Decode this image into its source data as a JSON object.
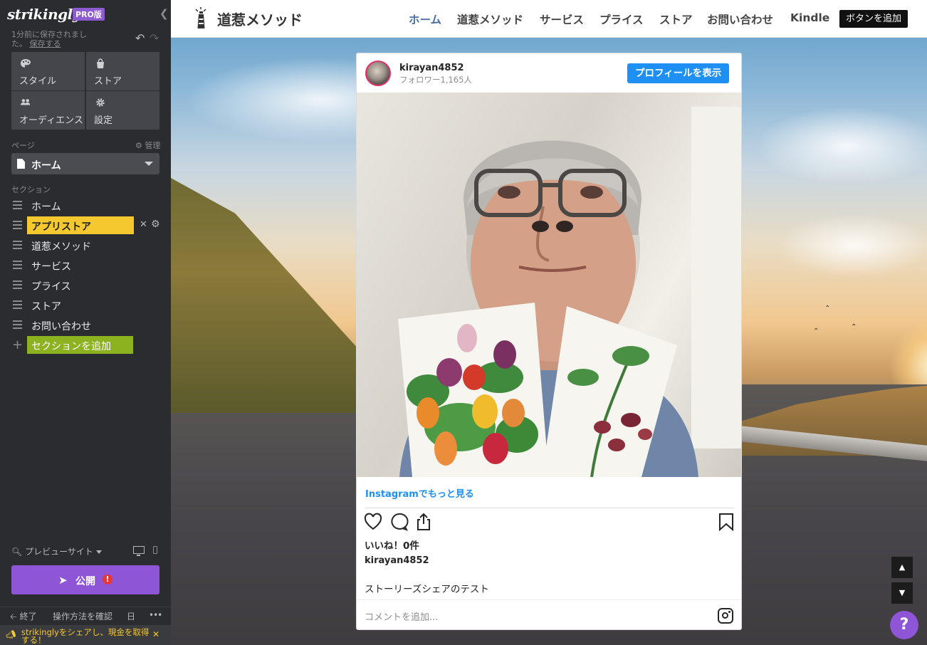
{
  "sidebar": {
    "brand": "strikingly",
    "pro_badge": "PRO版",
    "saved_text": "1分前に保存されました。",
    "save_link": "保存する",
    "tiles": [
      {
        "label": "スタイル",
        "icon": "palette-icon"
      },
      {
        "label": "ストア",
        "icon": "shopping-bag-icon"
      },
      {
        "label": "オーディエンス",
        "icon": "people-icon"
      },
      {
        "label": "設定",
        "icon": "gear-icon"
      }
    ],
    "page_label": "ページ",
    "manage_label": "管理",
    "current_page": "ホーム",
    "section_label": "セクション",
    "sections": [
      {
        "label": "ホーム",
        "active": false
      },
      {
        "label": "アプリストア",
        "active": true
      },
      {
        "label": "道惹メソッド",
        "active": false
      },
      {
        "label": "サービス",
        "active": false
      },
      {
        "label": "プライス",
        "active": false
      },
      {
        "label": "ストア",
        "active": false
      },
      {
        "label": "お問い合わせ",
        "active": false
      }
    ],
    "add_section": "セクションを追加",
    "preview": "プレビューサイト",
    "publish": "公開",
    "publish_badge": "!",
    "footer": {
      "exit": "終了",
      "howto": "操作方法を確認",
      "lang": "日",
      "more": "•••"
    },
    "banner": "strikinglyをシェアし、現金を取得する！",
    "colors": {
      "bg": "#2b2c2f",
      "active_section": "#f4c82e",
      "add_section": "#8cb21f",
      "publish": "#8e56d6"
    }
  },
  "site": {
    "logo_text": "道惹メソッド",
    "nav": [
      "ホーム",
      "道惹メソッド",
      "サービス",
      "プライス",
      "ストア",
      "お問い合わせ",
      "Kindle"
    ],
    "nav_current": "ホーム",
    "add_button": "ボタンを追加",
    "instagram": {
      "username": "kirayan4852",
      "followers": "フォロワー1,165人",
      "view_profile": "プロフィールを表示",
      "see_more": "Instagramでもっと見る",
      "likes": "いいね！0件",
      "caption_user": "kirayan4852",
      "caption": "ストーリーズシェアのテスト",
      "comment_placeholder": "コメントを追加...",
      "accent": "#1e90f3"
    },
    "help": "?"
  }
}
